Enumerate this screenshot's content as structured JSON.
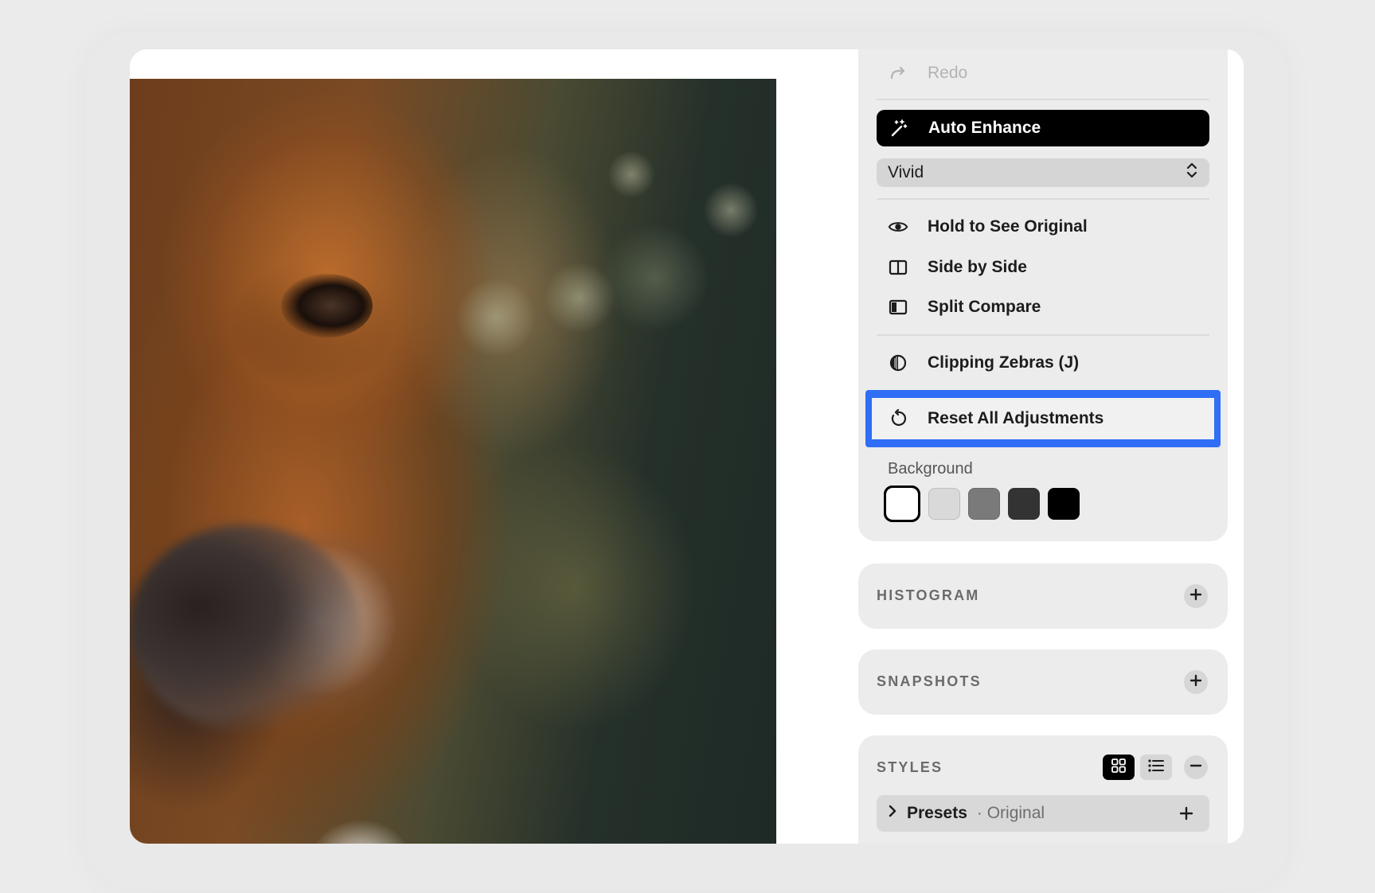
{
  "toolbar": {
    "redo_label": "Redo",
    "auto_enhance_label": "Auto Enhance",
    "enhance_mode": "Vivid"
  },
  "compare": {
    "hold_original": "Hold to See Original",
    "side_by_side": "Side by Side",
    "split_compare": "Split Compare",
    "clipping_zebras": "Clipping Zebras (J)",
    "reset_all": "Reset All Adjustments"
  },
  "background": {
    "label": "Background",
    "swatches": [
      "#ffffff",
      "#d9d9d9",
      "#7a7a7a",
      "#333333",
      "#000000"
    ],
    "selected_index": 0
  },
  "sections": {
    "histogram": "HISTOGRAM",
    "snapshots": "SNAPSHOTS",
    "styles": "STYLES"
  },
  "styles": {
    "presets_label": "Presets",
    "presets_value": "· Original"
  },
  "colors": {
    "accent_focus": "#2f6ef5",
    "primary_button": "#000000",
    "panel": "#ececec"
  },
  "icons": [
    "redo-icon",
    "magic-wand-icon",
    "chevron-updown-icon",
    "eye-icon",
    "side-by-side-icon",
    "split-compare-icon",
    "zebra-icon",
    "reset-icon",
    "plus-icon",
    "grid-icon",
    "list-icon",
    "minus-icon",
    "chevron-right-icon"
  ]
}
